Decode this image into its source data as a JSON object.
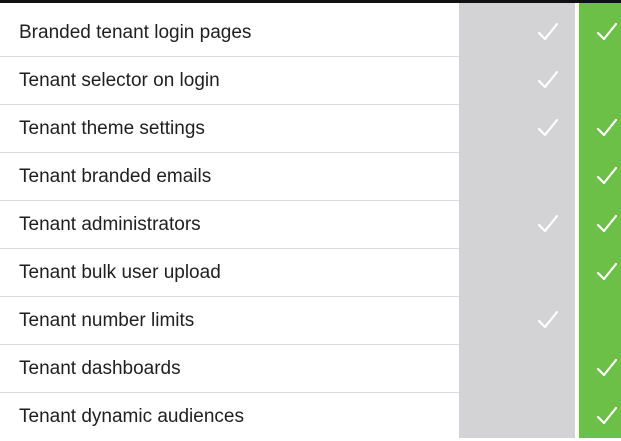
{
  "colors": {
    "plan_basic_column": "#d3d3d5",
    "plan_pro_column": "#6cbf47",
    "check_mark": "#ffffff",
    "text": "#1f1f1f"
  },
  "features": [
    {
      "label": "Branded tenant login pages",
      "basic": true,
      "pro": true
    },
    {
      "label": "Tenant selector on login",
      "basic": true,
      "pro": false
    },
    {
      "label": "Tenant theme settings",
      "basic": true,
      "pro": true
    },
    {
      "label": "Tenant branded emails",
      "basic": false,
      "pro": true
    },
    {
      "label": "Tenant administrators",
      "basic": true,
      "pro": true
    },
    {
      "label": "Tenant bulk user upload",
      "basic": false,
      "pro": true
    },
    {
      "label": "Tenant number limits",
      "basic": true,
      "pro": false
    },
    {
      "label": "Tenant dashboards",
      "basic": false,
      "pro": true
    },
    {
      "label": "Tenant dynamic audiences",
      "basic": false,
      "pro": true
    }
  ],
  "icons": {
    "included": "checkmark-icon"
  }
}
